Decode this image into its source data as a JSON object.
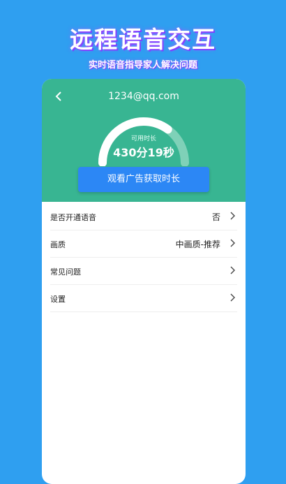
{
  "hero": {
    "title": "远程语音交互",
    "subtitle": "实时语音指导家人解决问题"
  },
  "header": {
    "back_icon": "chevron-left-icon",
    "account": "1234@qq.com"
  },
  "gauge": {
    "caption": "可用时长",
    "value": "430分19秒",
    "level_percent": 70,
    "colors": {
      "track": "#7fd1b8",
      "fill": "#ffffff"
    }
  },
  "cta": {
    "label": "观看广告获取时长"
  },
  "menu": [
    {
      "label": "是否开通语音",
      "value": "否"
    },
    {
      "label": "画质",
      "value": "中画质-推荐"
    },
    {
      "label": "常见问题",
      "value": ""
    },
    {
      "label": "设置",
      "value": ""
    }
  ],
  "colors": {
    "background": "#2f9ff0",
    "header": "#38b592",
    "button": "#2c87f5"
  }
}
